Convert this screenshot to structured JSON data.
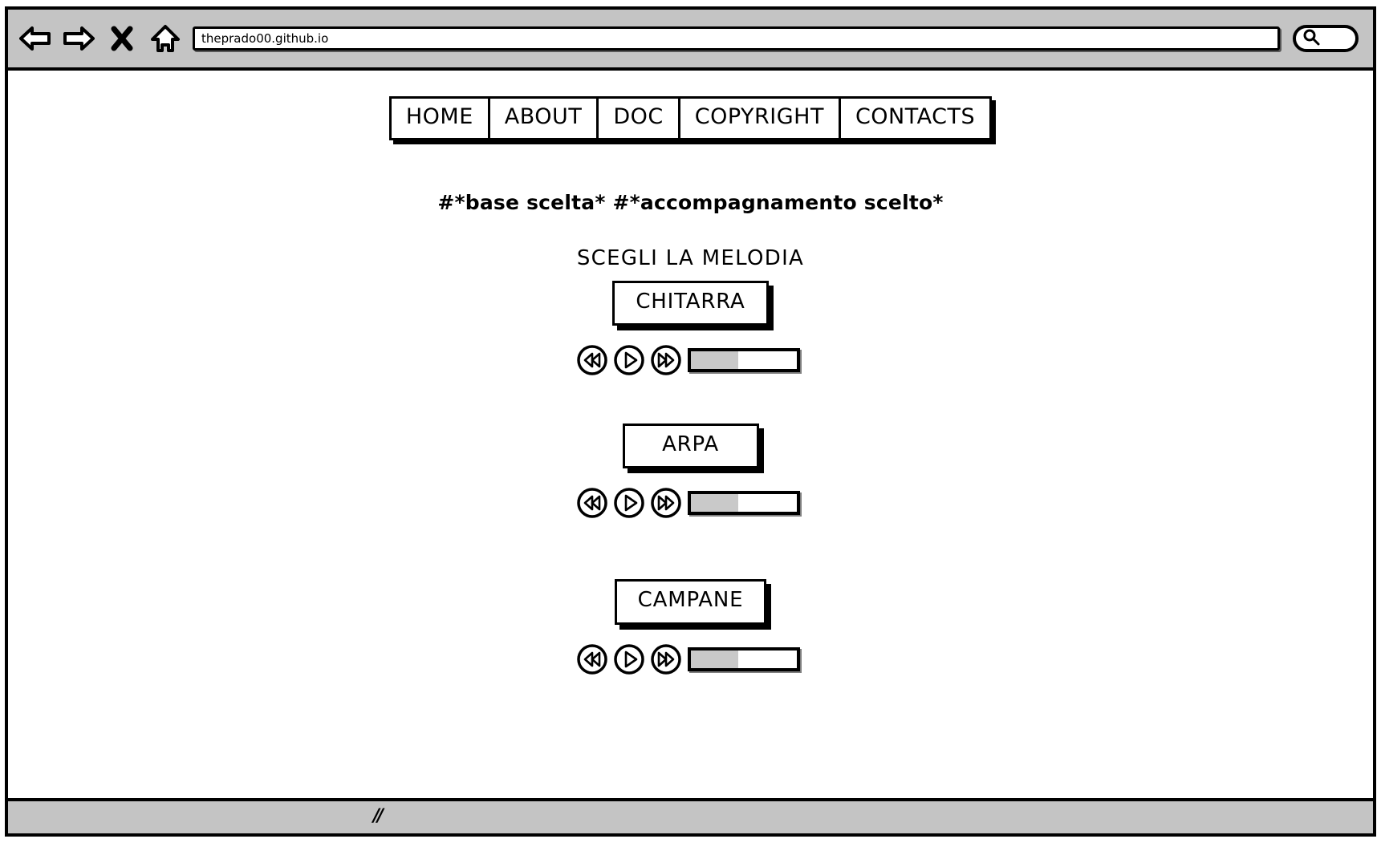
{
  "browser": {
    "back_icon": "back-arrow-icon",
    "forward_icon": "forward-arrow-icon",
    "stop_icon": "close-x-icon",
    "home_icon": "home-icon",
    "url_value": "theprado00.github.io",
    "url_placeholder": "",
    "search_icon": "search-icon",
    "search_value": "",
    "search_placeholder": "",
    "resize_handle": "//"
  },
  "nav": {
    "items": [
      {
        "label": "HOME"
      },
      {
        "label": "ABOUT"
      },
      {
        "label": "DOC"
      },
      {
        "label": "COPYRIGHT"
      },
      {
        "label": "CONTACTS"
      }
    ]
  },
  "main": {
    "subtitle": "#*base scelta* #*accompagnamento scelto*",
    "section_title": "SCEGLI LA MELODIA",
    "melodies": [
      {
        "name": "CHITARRA",
        "rewind_icon": "rewind-icon",
        "play_icon": "play-icon",
        "forward_icon": "fast-forward-icon",
        "progress_percent": 45
      },
      {
        "name": "ARPA",
        "rewind_icon": "rewind-icon",
        "play_icon": "play-icon",
        "forward_icon": "fast-forward-icon",
        "progress_percent": 45
      },
      {
        "name": "CAMPANE",
        "rewind_icon": "rewind-icon",
        "play_icon": "play-icon",
        "forward_icon": "fast-forward-icon",
        "progress_percent": 45
      }
    ]
  },
  "colors": {
    "chrome": "#c4c4c4",
    "outline": "#000000",
    "page": "#ffffff",
    "progress_fill": "#c9c9c9"
  }
}
